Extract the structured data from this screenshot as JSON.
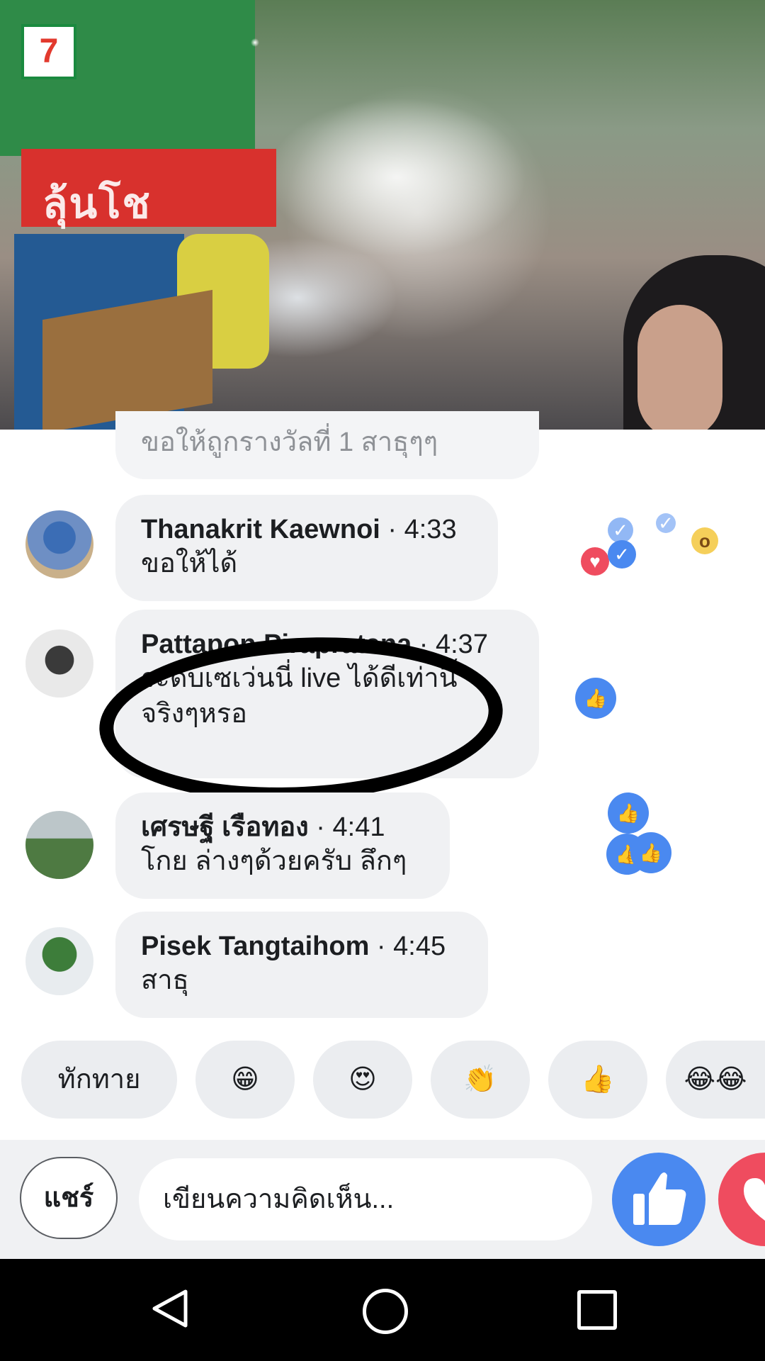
{
  "video": {
    "logo": "7",
    "sign_text": "ลุ้นโช"
  },
  "comments": {
    "partial_text": "ขอให้ถูกรางวัลที่ 1 สาธุๆๆ",
    "items": [
      {
        "name": "Thanakrit Kaewnoi",
        "time": " · 4:33",
        "text": "ขอให้ได้"
      },
      {
        "name": "Pattapon Pirapratana",
        "time": " · 4:37",
        "text": "ระดับเซเว่นนี่ live ได้ดีเท่านี้ จริงๆหรอ"
      },
      {
        "name": "เศรษฐี เรือทอง",
        "time": " · 4:41",
        "text": "โกย ล่างๆด้วยครับ ลึกๆ"
      },
      {
        "name": "Pisek Tangtaihom",
        "time": " · 4:45",
        "text": "สาธุ"
      }
    ]
  },
  "quick_replies": {
    "greeting": "ทักทาย",
    "emoji_1": "😁",
    "emoji_2": "😍",
    "emoji_3": "👏",
    "emoji_4": "👍",
    "emoji_5": "😂😂"
  },
  "composer": {
    "share_label": "แชร์",
    "comment_placeholder": "เขียนความคิดเห็น..."
  },
  "colors": {
    "like": "#4a89f0",
    "love": "#ef4c5f",
    "bubble": "#f0f1f3"
  }
}
